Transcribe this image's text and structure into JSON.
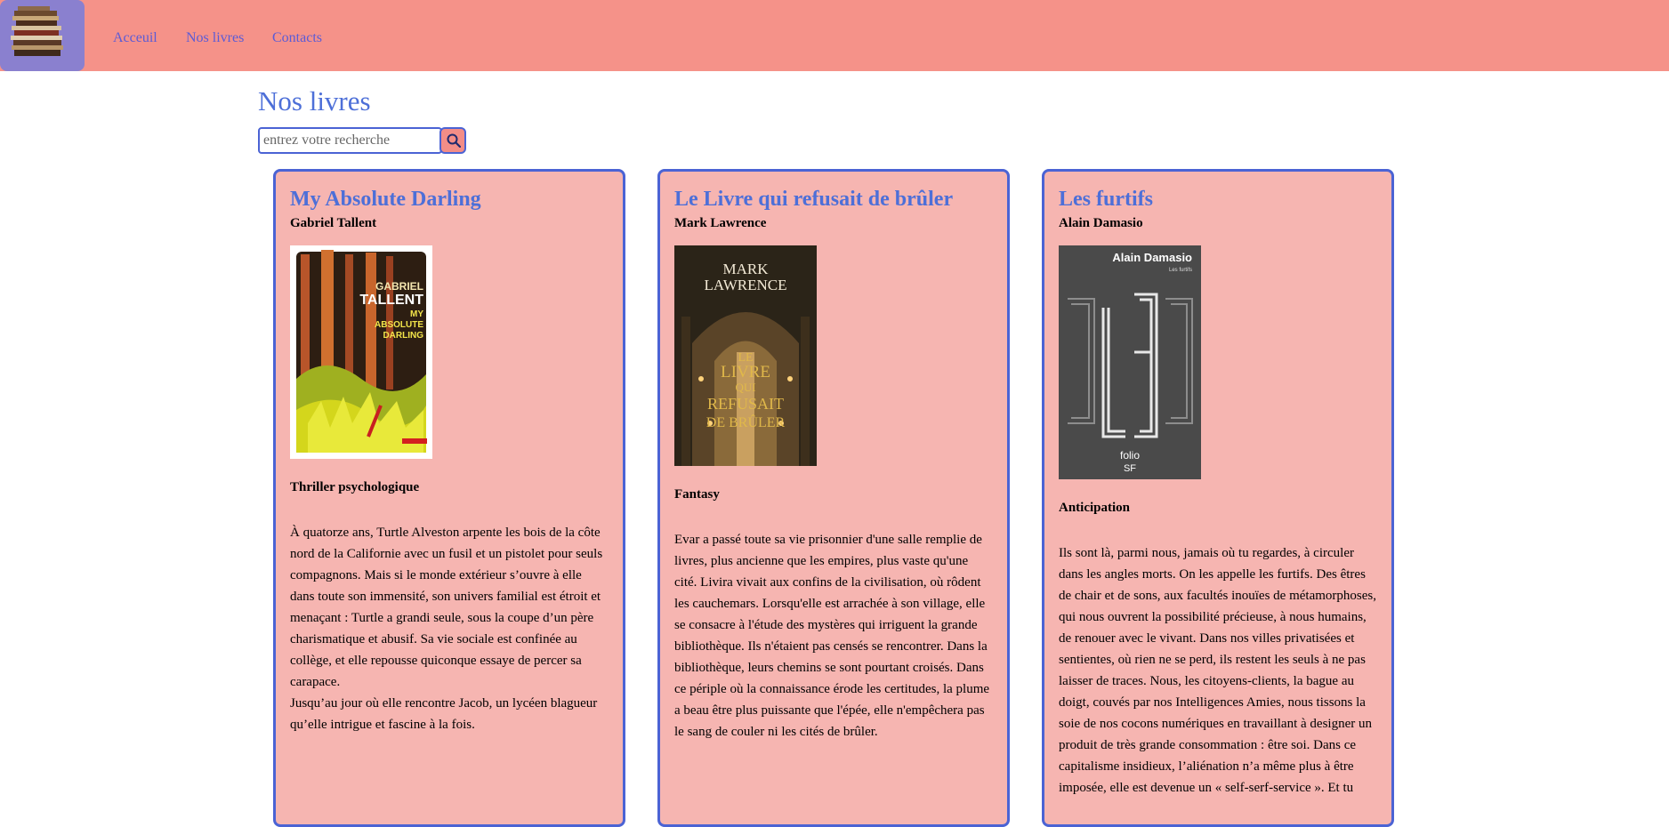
{
  "nav": {
    "links": [
      {
        "label": "Acceuil"
      },
      {
        "label": "Nos livres"
      },
      {
        "label": "Contacts"
      }
    ]
  },
  "page": {
    "title": "Nos livres"
  },
  "search": {
    "placeholder": "entrez votre recherche",
    "value": ""
  },
  "books": [
    {
      "title": "My Absolute Darling",
      "author": "Gabriel Tallent",
      "genre": "Thriller psychologique",
      "cover_lines": [
        "GABRIEL",
        "TALLENT",
        "MY",
        "ABSOLUTE",
        "DARLING"
      ],
      "description": "À quatorze ans, Turtle Alveston arpente les bois de la côte nord de la Californie avec un fusil et un pistolet pour seuls compagnons. Mais si le monde extérieur s’ouvre à elle dans toute son immensité, son univers familial est étroit et menaçant : Turtle a grandi seule, sous la coupe d’un père charismatique et abusif. Sa vie sociale est confinée au collège, et elle repousse quiconque essaye de percer sa carapace.",
      "description_2": "Jusqu’au jour où elle rencontre Jacob, un lycéen blagueur qu’elle intrigue et fascine à la fois."
    },
    {
      "title": "Le Livre qui refusait de brûler",
      "author": "Mark Lawrence",
      "genre": "Fantasy",
      "cover_lines": [
        "MARK",
        "LAWRENCE",
        "LE",
        "LIVRE",
        "QUI",
        "REFUSAIT",
        "DE BRÛLER"
      ],
      "description": "Evar a passé toute sa vie prisonnier d'une salle remplie de livres, plus ancienne que les empires, plus vaste qu'une cité. Livira vivait aux confins de la civilisation, où rôdent les cauchemars. Lorsqu'elle est arrachée à son village, elle se consacre à l'étude des mystères qui irriguent la grande bibliothèque. Ils n'étaient pas censés se rencontrer. Dans la bibliothèque, leurs chemins se sont pourtant croisés. Dans ce périple où la connaissance érode les certitudes, la plume a beau être plus puissante que l'épée, elle n'empêchera pas le sang de couler ni les cités de brûler.",
      "description_2": ""
    },
    {
      "title": "Les furtifs",
      "author": "Alain Damasio",
      "genre": "Anticipation",
      "cover_lines": [
        "Alain Damasio",
        "Les furtifs",
        "LES",
        "FURTIFS",
        "folio",
        "SF"
      ],
      "description": "Ils sont là, parmi nous, jamais où tu regardes, à circuler dans les angles morts. On les appelle les furtifs. Des êtres de chair et de sons, aux facultés inouïes de métamorphoses, qui nous ouvrent la possibilité précieuse, à nous humains, de renouer avec le vivant. Dans nos villes privatisées et sentientes, où rien ne se perd, ils restent les seuls à ne pas laisser de traces. Nous, les citoyens-clients, la bague au doigt, couvés par nos Intelligences Amies, nous tissons la soie de nos cocons numériques en travaillant à designer un produit de très grande consommation : être soi. Dans ce capitalisme insidieux, l’aliénation n’a même plus à être imposée, elle est devenue un « self-serf-service ». Et tu",
      "description_2": ""
    }
  ],
  "colors": {
    "navbar": "#f59289",
    "logo_bg": "#8a80cf",
    "card_bg": "#f6b5b1",
    "accent_blue": "#4b63d4",
    "title_blue": "#4d6fd8"
  }
}
